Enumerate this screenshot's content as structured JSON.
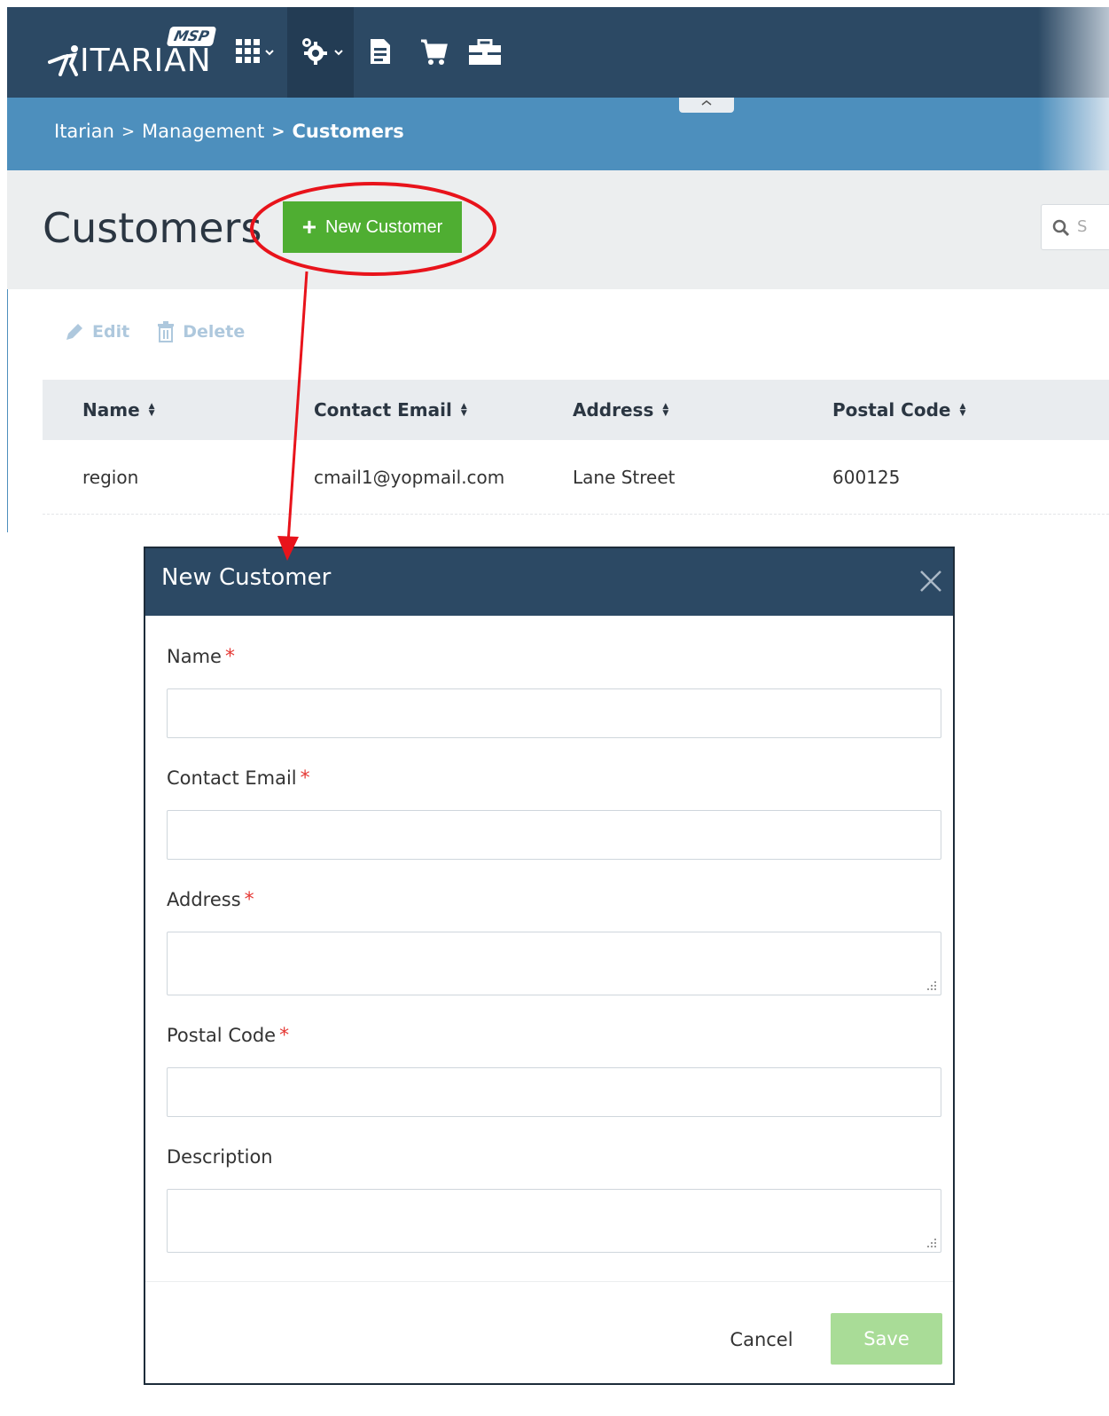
{
  "colors": {
    "topbar": "#2c4964",
    "breadcrumb_bar": "#4d8fbd",
    "primary_green": "#4fae32",
    "save_disabled": "#a9dc97",
    "required": "#e53935",
    "annotation_red": "#e8131b"
  },
  "logo": {
    "badge": "MSP",
    "word": "ITARIAN"
  },
  "nav": {
    "icons": [
      "apps-grid-icon",
      "settings-gear-icon",
      "document-icon",
      "cart-icon",
      "toolbox-icon"
    ]
  },
  "breadcrumb": {
    "items": [
      "Itarian",
      "Management",
      "Customers"
    ],
    "separator": ">"
  },
  "page": {
    "title": "Customers",
    "new_button": "New Customer",
    "search_placeholder": "S"
  },
  "toolbar": {
    "edit": "Edit",
    "delete": "Delete"
  },
  "table": {
    "columns": [
      "Name",
      "Contact Email",
      "Address",
      "Postal Code"
    ],
    "rows": [
      [
        "region",
        "cmail1@yopmail.com",
        "Lane Street",
        "600125"
      ]
    ]
  },
  "modal": {
    "title": "New Customer",
    "fields": [
      {
        "label": "Name",
        "required": "*",
        "value": ""
      },
      {
        "label": "Contact Email",
        "required": "*",
        "value": ""
      },
      {
        "label": "Address",
        "required": "*",
        "value": ""
      },
      {
        "label": "Postal Code",
        "required": "*",
        "value": ""
      },
      {
        "label": "Description",
        "required": "",
        "value": ""
      }
    ],
    "cancel": "Cancel",
    "save": "Save"
  }
}
